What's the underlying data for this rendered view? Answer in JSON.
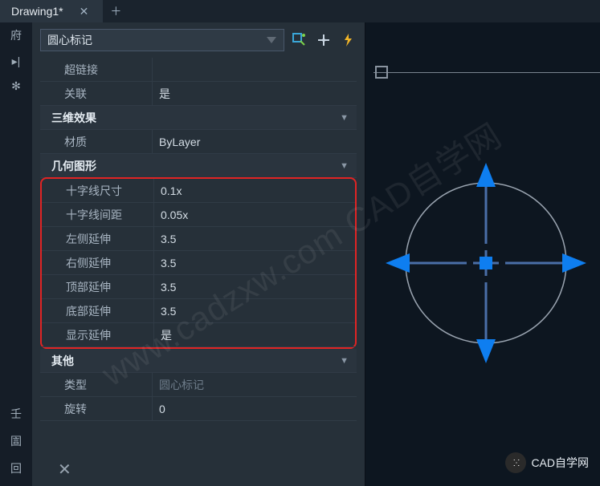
{
  "tab": {
    "title": "Drawing1*"
  },
  "selector": {
    "value": "圆心标记"
  },
  "rows_top": [
    {
      "label": "超链接",
      "value": ""
    },
    {
      "label": "关联",
      "value": "是"
    }
  ],
  "sections": {
    "s1": "三维效果",
    "s2": "几何图形",
    "s3": "其他"
  },
  "rows_s1": [
    {
      "label": "材质",
      "value": "ByLayer"
    }
  ],
  "rows_s2": [
    {
      "label": "十字线尺寸",
      "value": "0.1x"
    },
    {
      "label": "十字线间距",
      "value": "0.05x"
    },
    {
      "label": "左侧延伸",
      "value": "3.5"
    },
    {
      "label": "右侧延伸",
      "value": "3.5"
    },
    {
      "label": "顶部延伸",
      "value": "3.5"
    },
    {
      "label": "底部延伸",
      "value": "3.5"
    },
    {
      "label": "显示延伸",
      "value": "是"
    }
  ],
  "rows_s3": [
    {
      "label": "类型",
      "value": "圆心标记",
      "dim": true
    },
    {
      "label": "旋转",
      "value": "0"
    }
  ],
  "watermark": "www.cadzxw.com CAD自学网",
  "brand": "CAD自学网"
}
